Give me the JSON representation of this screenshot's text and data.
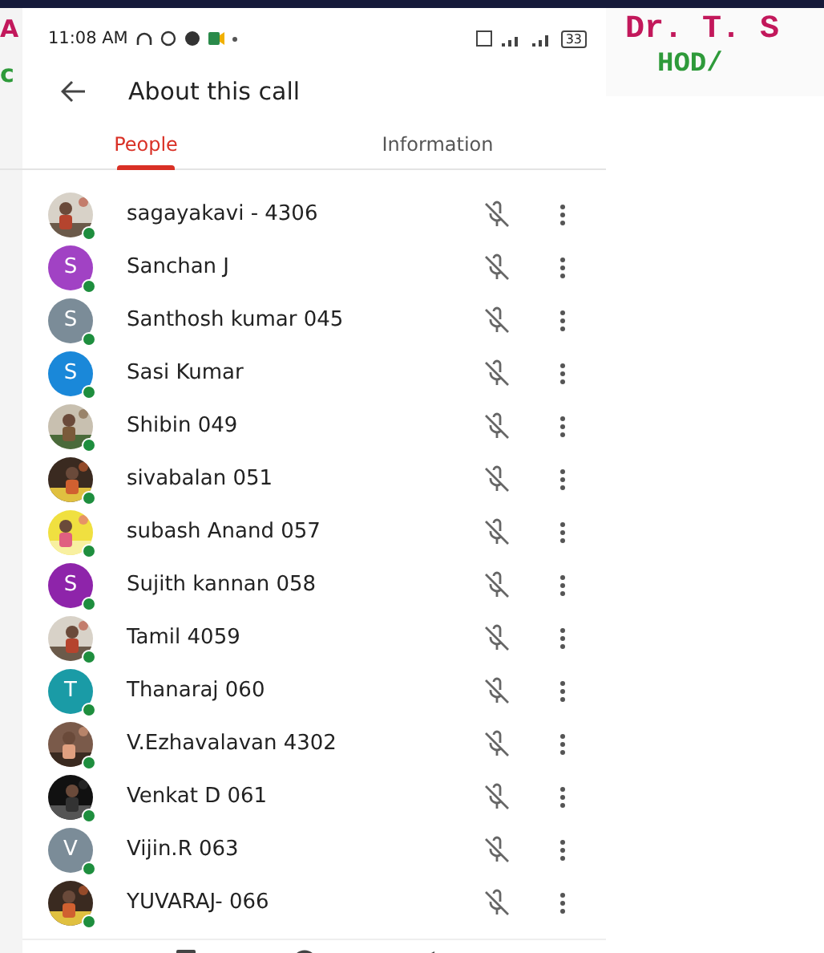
{
  "backdrop": {
    "left_texts": [
      "A",
      "c"
    ],
    "right_texts": [
      "Dr. T. S",
      "HOD/"
    ]
  },
  "status_bar": {
    "time": "11:08 AM",
    "battery": "33"
  },
  "header": {
    "title": "About this call"
  },
  "tabs": [
    {
      "label": "People",
      "selected": true
    },
    {
      "label": "Information",
      "selected": false
    }
  ],
  "participants": [
    {
      "name": "sagayakavi - 4306"
    },
    {
      "name": "Sanchan J",
      "avatar": {
        "kind": "letter",
        "letter": "S",
        "color": "#a142c4"
      }
    },
    {
      "name": "Santhosh kumar 045",
      "avatar": {
        "kind": "letter",
        "letter": "S",
        "color": "#7b8c98"
      }
    },
    {
      "name": "Sasi Kumar",
      "avatar": {
        "kind": "letter",
        "letter": "S",
        "color": "#1a88d9"
      }
    },
    {
      "name": "Shibin 049"
    },
    {
      "name": "sivabalan 051"
    },
    {
      "name": "subash Anand 057"
    },
    {
      "name": "Sujith kannan 058",
      "avatar": {
        "kind": "letter",
        "letter": "S",
        "color": "#8e24aa"
      }
    },
    {
      "name": "Tamil 4059"
    },
    {
      "name": "Thanaraj 060",
      "avatar": {
        "kind": "letter",
        "letter": "T",
        "color": "#1a9ba6"
      }
    },
    {
      "name": "V.Ezhavalavan 4302"
    },
    {
      "name": "Venkat D 061"
    },
    {
      "name": "Vijin.R 063",
      "avatar": {
        "kind": "letter",
        "letter": "V",
        "color": "#7b8c98"
      }
    },
    {
      "name": "YUVARAJ- 066"
    }
  ]
}
